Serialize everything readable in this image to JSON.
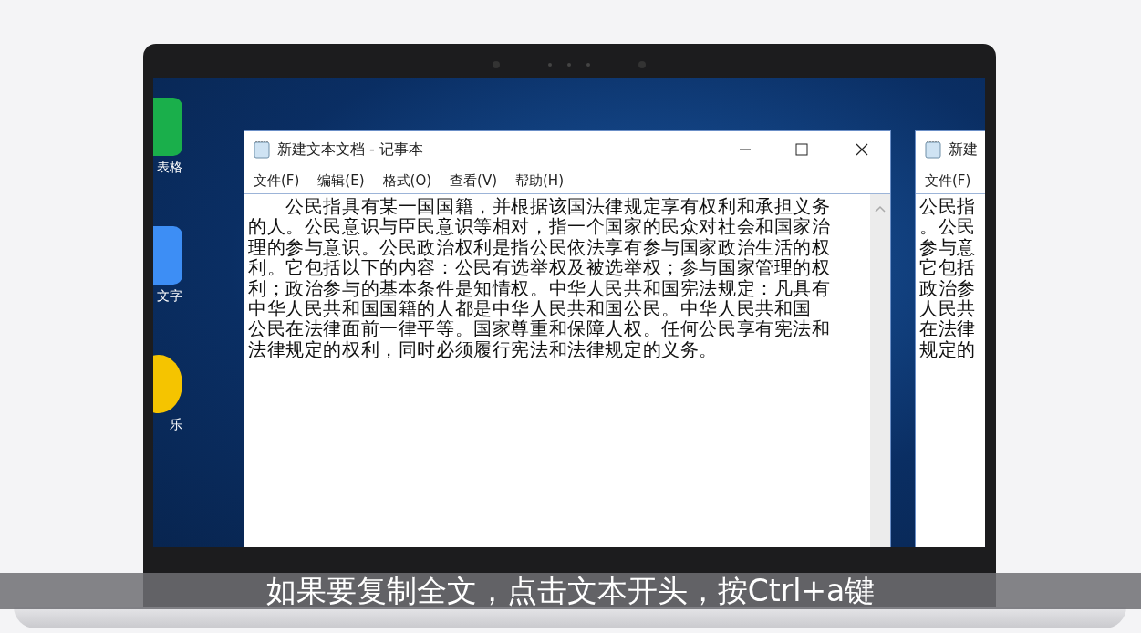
{
  "desktop_icons": [
    {
      "label": "表格",
      "color": "#1aaf4b"
    },
    {
      "label": "文字",
      "color": "#3d8ef5"
    },
    {
      "label": "乐",
      "color": "#f5c400"
    }
  ],
  "notepad": {
    "title": "新建文本文档 - 记事本",
    "menu": [
      "文件(F)",
      "编辑(E)",
      "格式(O)",
      "查看(V)",
      "帮助(H)"
    ],
    "lines": [
      "　　公民指具有某一国国籍，并根据该国法律规定享有权利和承担义务",
      "的人。公民意识与臣民意识等相对，指一个国家的民众对社会和国家治",
      "理的参与意识。公民政治权利是指公民依法享有参与国家政治生活的权",
      "利。它包括以下的内容：公民有选举权及被选举权；参与国家管理的权",
      "利；政治参与的基本条件是知情权。中华人民共和国宪法规定：凡具有",
      "中华人民共和国国籍的人都是中华人民共和国公民。中华人民共和国",
      "公民在法律面前一律平等。国家尊重和保障人权。任何公民享有宪法和",
      "法律规定的权利，同时必须履行宪法和法律规定的义务。"
    ]
  },
  "second_window": {
    "title": "新建",
    "menu": [
      "文件(F)"
    ],
    "lines": [
      "公民指",
      "。公民",
      "参与意",
      "它包括",
      "政治参",
      "人民共",
      "在法律",
      "规定的"
    ]
  },
  "caption": "如果要复制全文，点击文本开头，按Ctrl+a键"
}
